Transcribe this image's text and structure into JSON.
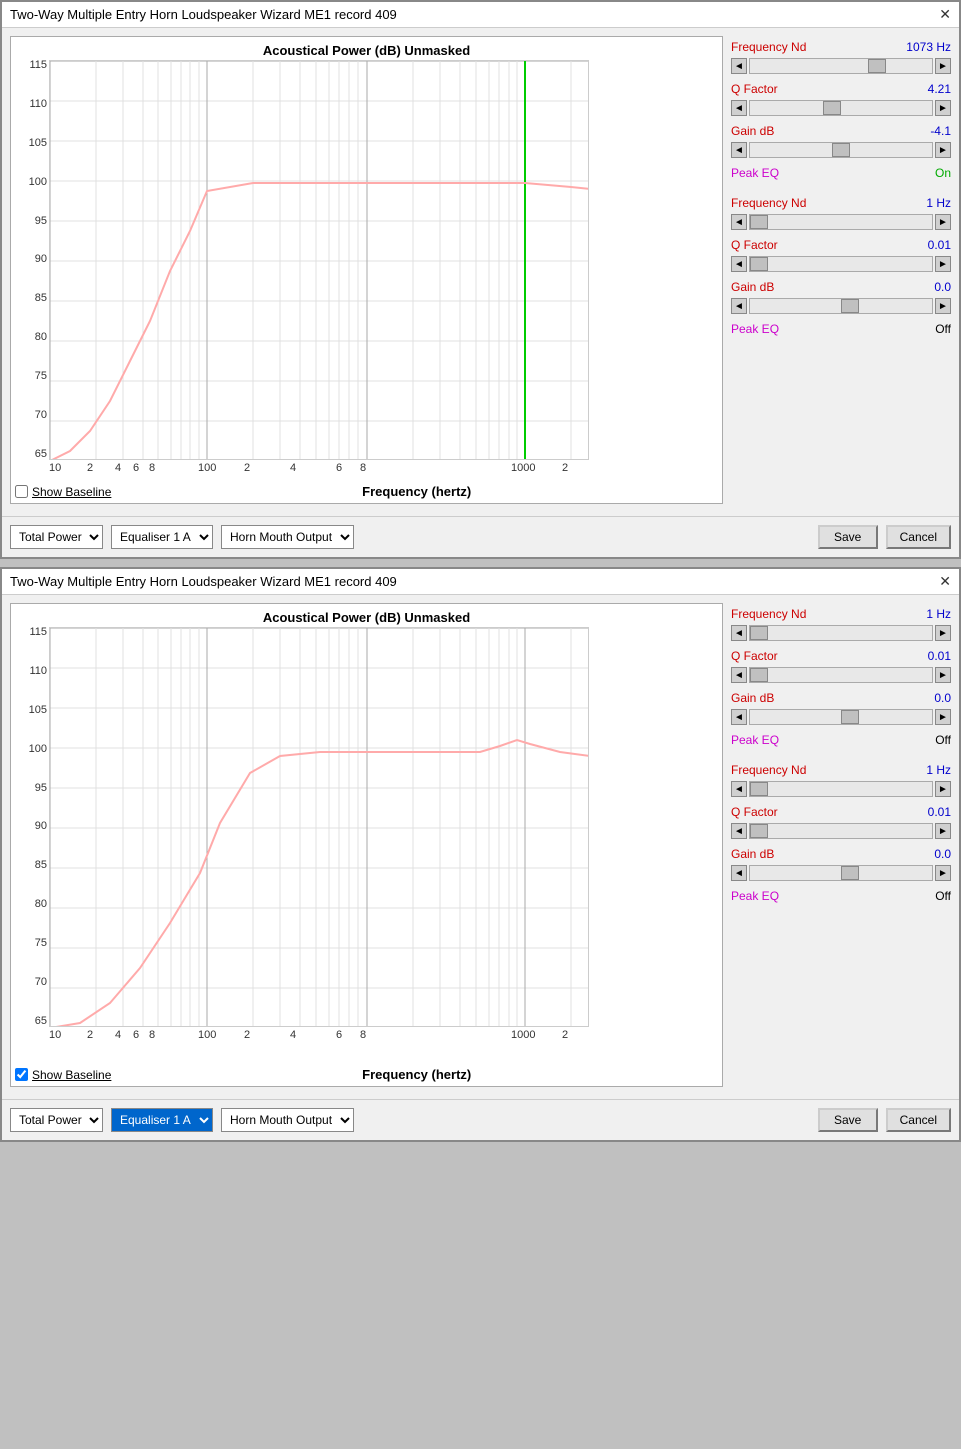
{
  "window1": {
    "title": "Two-Way Multiple Entry Horn Loudspeaker Wizard   ME1 record 409",
    "chart": {
      "title": "Acoustical Power (dB)   Unmasked",
      "y_labels": [
        "115",
        "110",
        "105",
        "100",
        "95",
        "90",
        "85",
        "80",
        "75",
        "70",
        "65"
      ],
      "x_labels": [
        "10",
        "2",
        "4",
        "6",
        "8",
        "100",
        "2",
        "4",
        "6",
        "8",
        "1000",
        "2"
      ],
      "x_axis_title": "Frequency (hertz)",
      "show_baseline": false,
      "show_baseline_label": "Show Baseline",
      "has_green_line": true
    },
    "eq1": {
      "freq_label": "Frequency Nd",
      "freq_value": "1073 Hz",
      "q_label": "Q Factor",
      "q_value": "4.21",
      "gain_label": "Gain dB",
      "gain_value": "-4.1",
      "peak_eq_label": "Peak EQ",
      "peak_eq_value": "On",
      "peak_eq_color": "green"
    },
    "eq2": {
      "freq_label": "Frequency Nd",
      "freq_value": "1 Hz",
      "q_label": "Q Factor",
      "q_value": "0.01",
      "gain_label": "Gain dB",
      "gain_value": "0.0",
      "peak_eq_label": "Peak EQ",
      "peak_eq_value": "Off",
      "peak_eq_color": "black"
    },
    "bottom": {
      "dropdown1_value": "Total Power",
      "dropdown2_value": "Equaliser 1 A",
      "dropdown3_value": "Horn Mouth Output",
      "save_label": "Save",
      "cancel_label": "Cancel"
    }
  },
  "window2": {
    "title": "Two-Way Multiple Entry Horn Loudspeaker Wizard   ME1 record 409",
    "chart": {
      "title": "Acoustical Power (dB)   Unmasked",
      "y_labels": [
        "115",
        "110",
        "105",
        "100",
        "95",
        "90",
        "85",
        "80",
        "75",
        "70",
        "65"
      ],
      "x_labels": [
        "10",
        "2",
        "4",
        "6",
        "8",
        "100",
        "2",
        "4",
        "6",
        "8",
        "1000",
        "2"
      ],
      "x_axis_title": "Frequency (hertz)",
      "show_baseline": true,
      "show_baseline_label": "Show Baseline",
      "has_green_line": false
    },
    "eq1": {
      "freq_label": "Frequency Nd",
      "freq_value": "1 Hz",
      "q_label": "Q Factor",
      "q_value": "0.01",
      "gain_label": "Gain dB",
      "gain_value": "0.0",
      "peak_eq_label": "Peak EQ",
      "peak_eq_value": "Off",
      "peak_eq_color": "black"
    },
    "eq2": {
      "freq_label": "Frequency Nd",
      "freq_value": "1 Hz",
      "q_label": "Q Factor",
      "q_value": "0.01",
      "gain_label": "Gain dB",
      "gain_value": "0.0",
      "peak_eq_label": "Peak EQ",
      "peak_eq_value": "Off",
      "peak_eq_color": "black"
    },
    "bottom": {
      "dropdown1_value": "Total Power",
      "dropdown2_value": "Equaliser 1 A",
      "dropdown3_value": "Horn Mouth Output",
      "save_label": "Save",
      "cancel_label": "Cancel",
      "dropdown2_highlighted": true
    }
  }
}
